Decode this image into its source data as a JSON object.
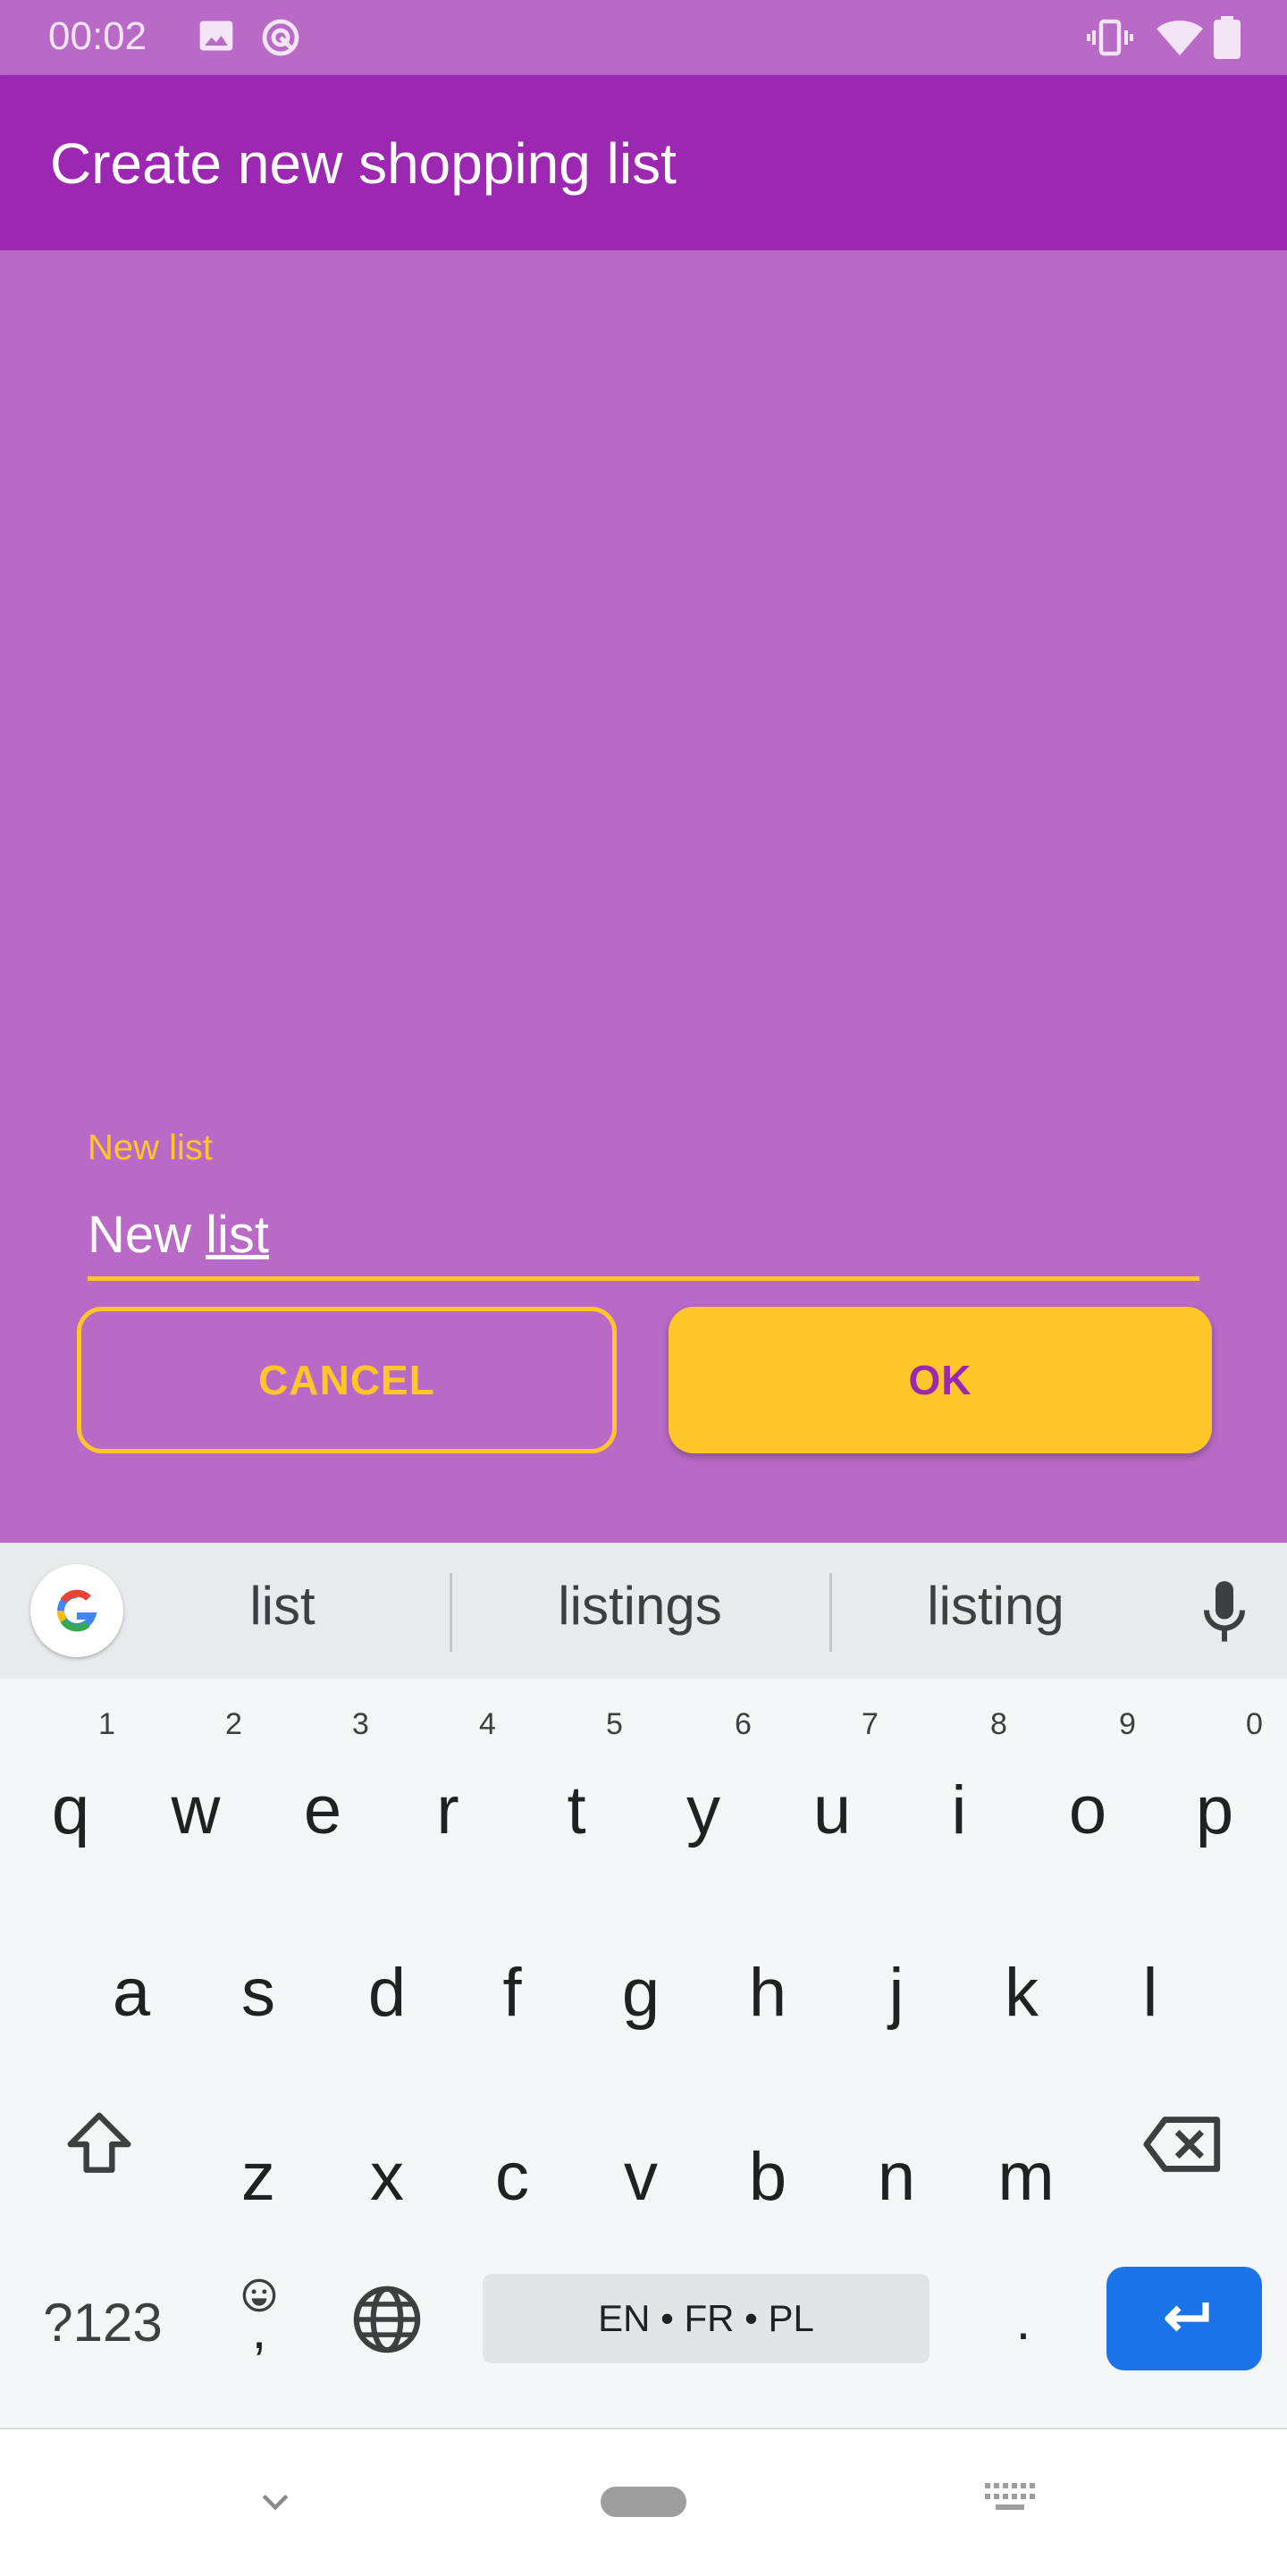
{
  "status_bar": {
    "time": "00:02",
    "icons": [
      "image-icon",
      "sync-icon",
      "vibrate-icon",
      "wifi-icon",
      "battery-icon"
    ]
  },
  "app_bar": {
    "title": "Create new shopping list"
  },
  "form": {
    "label": "New list",
    "value_word1": "New",
    "value_word2": "list",
    "cancel_label": "CANCEL",
    "ok_label": "OK"
  },
  "colors": {
    "primary": "#9c27b0",
    "background": "#b86ac6",
    "accent": "#ffc629",
    "enter_key": "#1a73e8"
  },
  "keyboard": {
    "suggestions": [
      "list",
      "listings",
      "listing"
    ],
    "row1": [
      "q",
      "w",
      "e",
      "r",
      "t",
      "y",
      "u",
      "i",
      "o",
      "p"
    ],
    "row1_hints": [
      "1",
      "2",
      "3",
      "4",
      "5",
      "6",
      "7",
      "8",
      "9",
      "0"
    ],
    "row2": [
      "a",
      "s",
      "d",
      "f",
      "g",
      "h",
      "j",
      "k",
      "l"
    ],
    "row3": [
      "z",
      "x",
      "c",
      "v",
      "b",
      "n",
      "m"
    ],
    "symbols_key": "?123",
    "comma_key": ",",
    "space_label": "EN • FR • PL",
    "period_key": "."
  }
}
